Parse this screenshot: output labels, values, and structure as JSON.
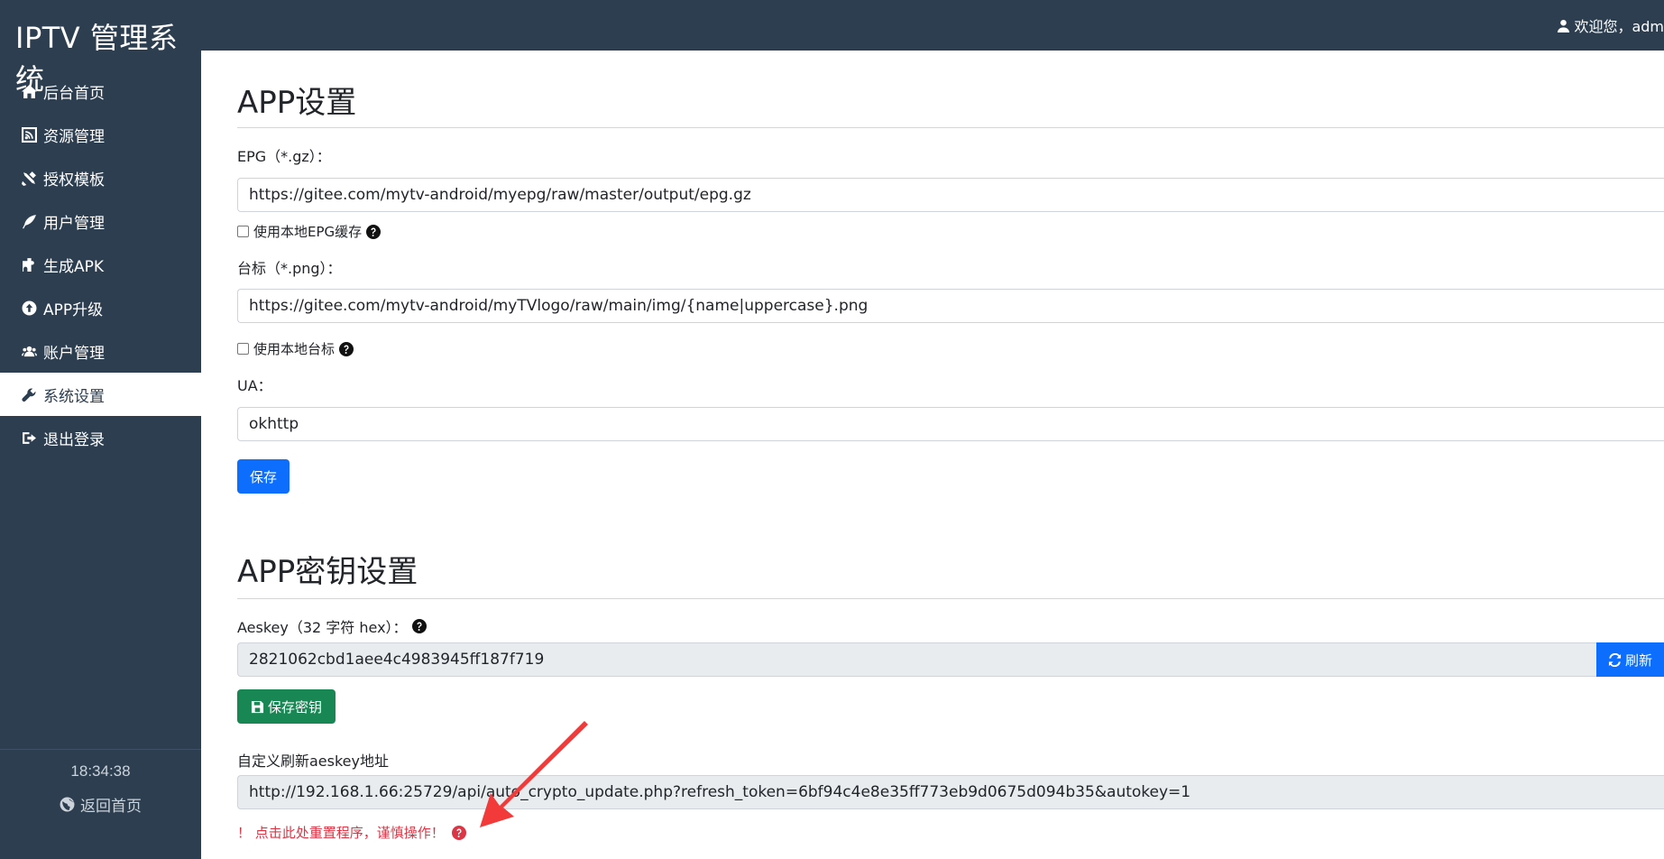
{
  "app": {
    "title": "IPTV 管理系统"
  },
  "sidebar": {
    "items": [
      {
        "label": "后台首页",
        "icon": "home-icon"
      },
      {
        "label": "资源管理",
        "icon": "rss-icon"
      },
      {
        "label": "授权模板",
        "icon": "tools-icon"
      },
      {
        "label": "用户管理",
        "icon": "feather-icon"
      },
      {
        "label": "生成APK",
        "icon": "puzzle-icon"
      },
      {
        "label": "APP升级",
        "icon": "arrow-up-circle-icon"
      },
      {
        "label": "账户管理",
        "icon": "users-icon"
      },
      {
        "label": "系统设置",
        "icon": "wrench-icon",
        "active": true
      },
      {
        "label": "退出登录",
        "icon": "sign-out-icon"
      }
    ],
    "clock": "18:34:38",
    "back_home": "返回首页"
  },
  "header": {
    "welcome": "欢迎您，adm"
  },
  "app_settings": {
    "title": "APP设置",
    "epg_label": "EPG（*.gz）：",
    "epg_value": "https://gitee.com/mytv-android/myepg/raw/master/output/epg.gz",
    "epg_cache_label": "使用本地EPG缓存",
    "logo_label": "台标（*.png）：",
    "logo_value": "https://gitee.com/mytv-android/myTVlogo/raw/main/img/{name|uppercase}.png",
    "logo_local_label": "使用本地台标",
    "ua_label": "UA：",
    "ua_value": "okhttp",
    "save_label": "保存"
  },
  "key_settings": {
    "title": "APP密钥设置",
    "aeskey_label": "Aeskey（32 字符 hex）：",
    "aeskey_value": "2821062cbd1aee4c4983945ff187f719",
    "refresh_label": "刷新",
    "save_key_label": "保存密钥",
    "custom_url_label": "自定义刷新aeskey地址",
    "custom_url_value": "http://192.168.1.66:25729/api/auto_crypto_update.php?refresh_token=6bf94c4e8e35ff773eb9d0675d094b35&autokey=1",
    "reset_warning": "！ 点击此处重置程序，谨慎操作！"
  },
  "colors": {
    "sidebar_bg": "#2c3e50",
    "primary": "#0d6efd",
    "success": "#198754",
    "danger": "#dc3545",
    "annotation_arrow": "#f23a3a"
  }
}
